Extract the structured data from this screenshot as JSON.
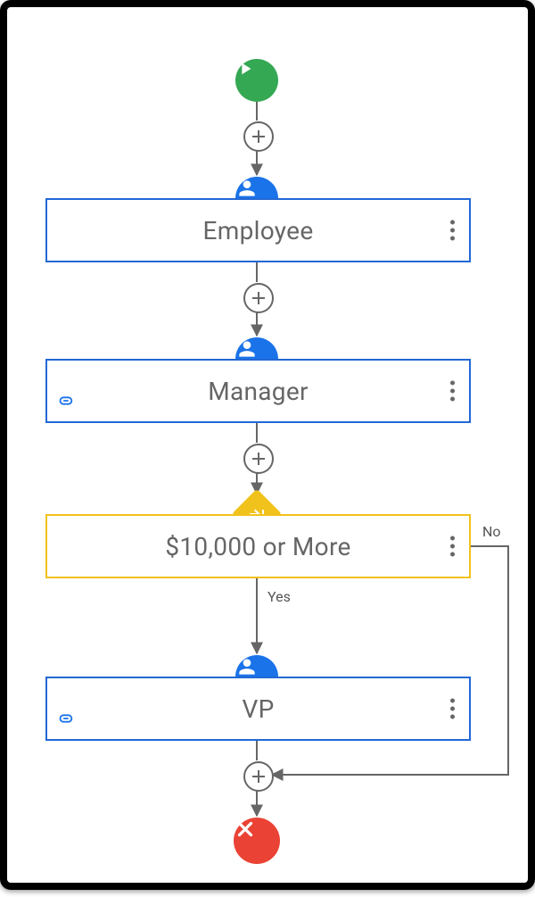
{
  "colors": {
    "start": "#34a853",
    "end": "#ea4335",
    "person": "#1a73e8",
    "decision": "#f1c21b",
    "blueBorder": "#2268d6",
    "yellowBorder": "#f1c21b",
    "line": "#666"
  },
  "nodes": {
    "employee": {
      "label": "Employee",
      "type": "user"
    },
    "manager": {
      "label": "Manager",
      "type": "user",
      "link": true
    },
    "decision": {
      "label": "$10,000 or More",
      "type": "decision"
    },
    "vp": {
      "label": "VP",
      "type": "user",
      "link": true
    }
  },
  "branches": {
    "yes": "Yes",
    "no": "No"
  },
  "layout": {
    "centerX": 280,
    "boxLeft": 43,
    "boxWidth": 477,
    "boxHeight": 72,
    "startY": 58,
    "plus1Y": 128,
    "emp_iconY": 190,
    "emp_boxY": 214,
    "plus2Y": 309,
    "mgr_iconY": 370,
    "mgr_boxY": 394,
    "plus3Y": 489,
    "dec_iconY": 548,
    "dec_boxY": 568,
    "yesLabelY": 655,
    "plus4Y_skip": null,
    "vp_iconY": 726,
    "vp_boxY": 750,
    "plus4Y": 845,
    "endY": 912,
    "noPathX": 562
  }
}
